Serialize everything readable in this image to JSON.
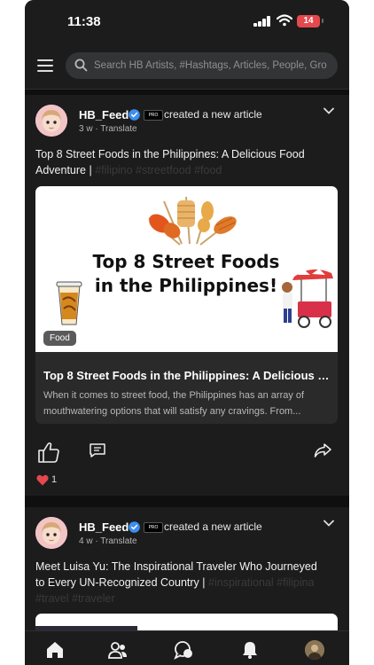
{
  "status_bar": {
    "time": "11:38",
    "battery": "14"
  },
  "search": {
    "placeholder": "Search HB Artists, #Hashtags, Articles, People, Gro"
  },
  "posts": [
    {
      "author": "HB_Feed",
      "action": "created a new article",
      "time": "3 w",
      "translate": "Translate",
      "title": "Top 8 Street Foods in the Philippines: A Delicious Food Adventure |",
      "tags": "#filipino #streetfood #food",
      "card": {
        "image_text_line1": "Top 8 Street Foods",
        "image_text_line2": "in the Philippines!",
        "category": "Food",
        "title": "Top 8 Street Foods in the Philippines: A Delicious F...",
        "description": "When it comes to street food, the Philippines has an array of mouthwatering options that will satisfy any cravings. From..."
      },
      "likes": "1"
    },
    {
      "author": "HB_Feed",
      "action": "created a new article",
      "time": "4 w",
      "translate": "Translate",
      "title": "Meet Luisa Yu: The Inspirational Traveler Who Journeyed to Every UN-Recognized Country |",
      "tags": "#inspirational #filipina #travel #traveler"
    }
  ],
  "bottom_nav": [
    "home-icon",
    "people-icon",
    "chat-icon",
    "bell-icon",
    "profile-avatar"
  ],
  "colors": {
    "background": "#1c1c1c",
    "verified": "#3d8ef0",
    "heart": "#e5484d",
    "battery": "#e5484d"
  }
}
